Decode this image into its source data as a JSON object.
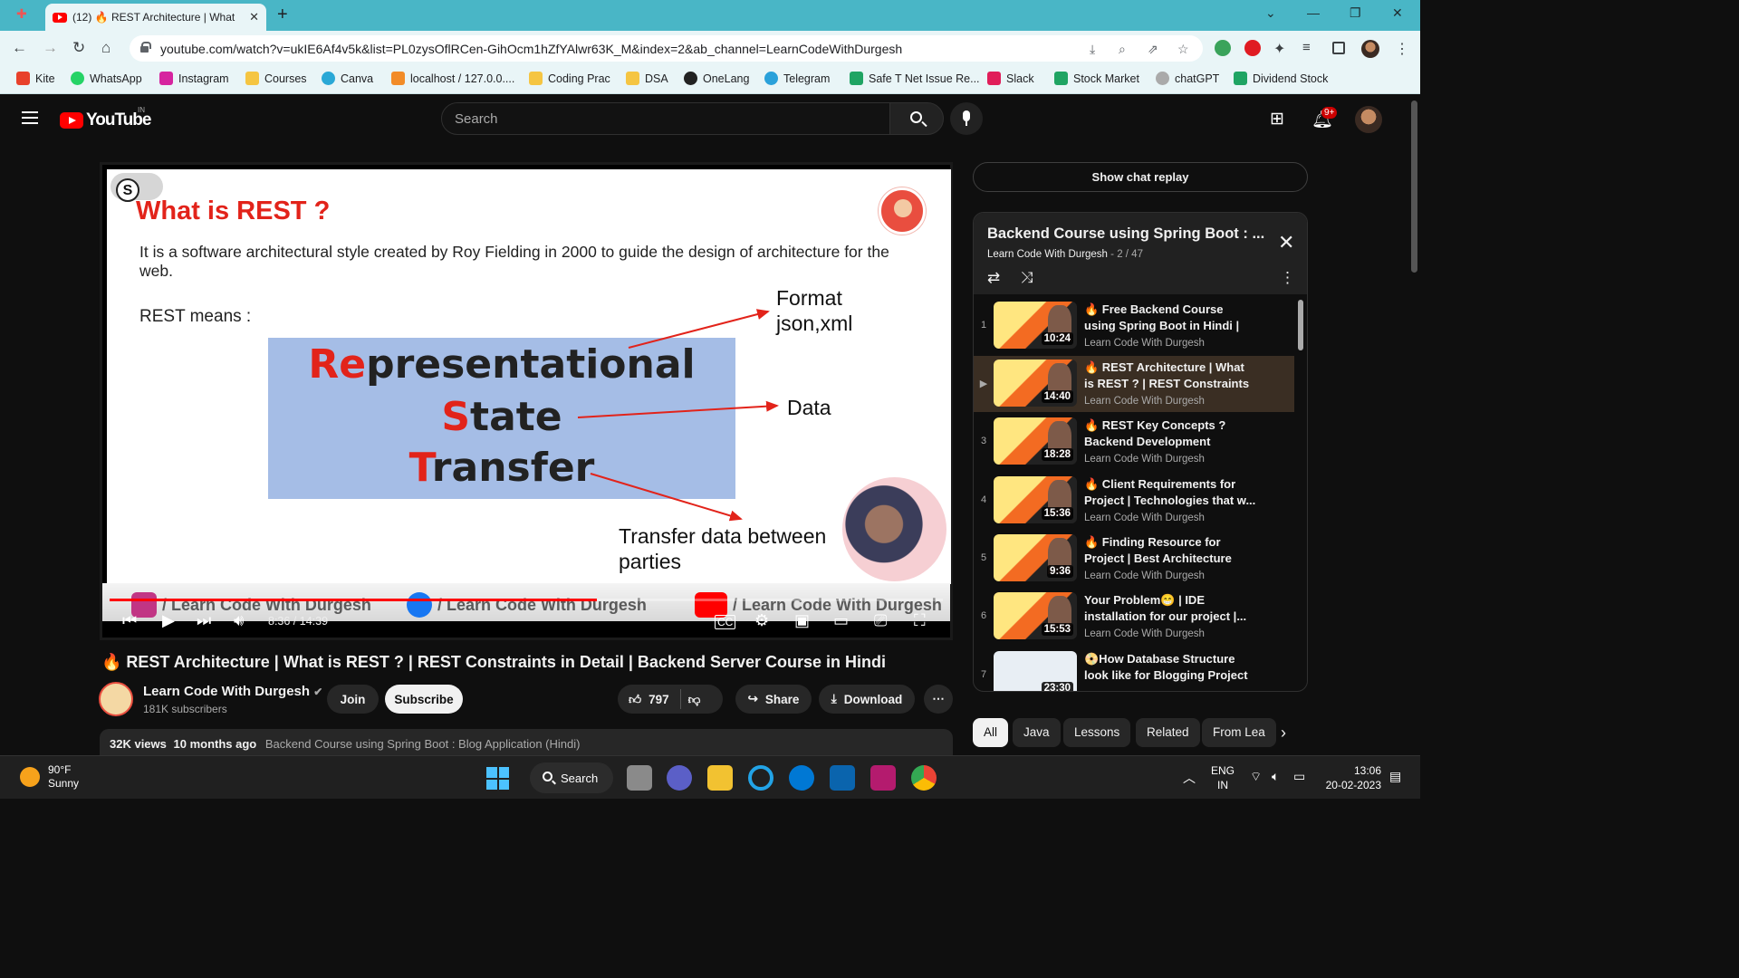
{
  "browser": {
    "tab_title": "(12) 🔥 REST Architecture | What",
    "url": "youtube.com/watch?v=ukIE6Af4v5k&list=PL0zysOflRCen-GihOcm1hZfYAlwr63K_M&index=2&ab_channel=LearnCodeWithDurgesh",
    "bookmarks": [
      "Kite",
      "WhatsApp",
      "Instagram",
      "Courses",
      "Canva",
      "localhost / 127.0.0....",
      "Coding Prac",
      "DSA",
      "OneLang",
      "Telegram",
      "Safe T Net Issue Re...",
      "Slack",
      "Stock Market",
      "chatGPT",
      "Dividend Stock"
    ]
  },
  "youtube": {
    "logo_text": "YouTube",
    "region": "IN",
    "search_placeholder": "Search",
    "notification_count": "9+"
  },
  "slide": {
    "toggle_letter": "S",
    "title": "What is REST  ?",
    "description": "It is a software architectural style created by Roy Fielding in 2000 to guide the design of architecture for the web.",
    "means_label": "REST means :",
    "word1_head": "Re",
    "word1_tail": "presentational",
    "word2_head": "S",
    "word2_tail": "tate",
    "word3_head": "T",
    "word3_tail": "ransfer",
    "note_format_1": "Format",
    "note_format_2": "json,xml",
    "note_data": "Data",
    "note_transfer_1": "Transfer data between",
    "note_transfer_2": "parties",
    "watermark_1": "/ Learn Code With Durgesh",
    "watermark_2": "/ Learn Code With Durgesh",
    "watermark_3": "/ Learn Code With Durgesh"
  },
  "player": {
    "time": "8:36 / 14:39",
    "progress_fraction": 0.585
  },
  "video": {
    "title": "🔥 REST Architecture | What is REST ? | REST Constraints in Detail | Backend Server Course in Hindi",
    "channel": "Learn Code With Durgesh",
    "subscribers": "181K subscribers",
    "join": "Join",
    "subscribe": "Subscribe",
    "likes": "797",
    "share": "Share",
    "download": "Download",
    "views": "32K views",
    "age": "10 months ago",
    "playlist_link": "Backend Course using Spring Boot : Blog Application (Hindi)"
  },
  "sidebar": {
    "chat_replay": "Show chat replay",
    "playlist_title": "Backend Course using Spring Boot : ...",
    "playlist_channel": "Learn Code With Durgesh",
    "playlist_position": " - 2 / 47",
    "items": [
      {
        "index": "1",
        "title": "🔥 Free Backend Course using Spring Boot in Hindi | Blog...",
        "channel": "Learn Code With Durgesh",
        "duration": "10:24"
      },
      {
        "index": "▶",
        "title": "🔥 REST Architecture | What is REST ? | REST Constraints in...",
        "channel": "Learn Code With Durgesh",
        "duration": "14:40"
      },
      {
        "index": "3",
        "title": "🔥 REST Key Concepts ? Backend Development Cours...",
        "channel": "Learn Code With Durgesh",
        "duration": "18:28"
      },
      {
        "index": "4",
        "title": "🔥 Client Requirements for Project | Technologies that w...",
        "channel": "Learn Code With Durgesh",
        "duration": "15:36"
      },
      {
        "index": "5",
        "title": "🔥 Finding Resource for Project | Best Architecture for...",
        "channel": "Learn Code With Durgesh",
        "duration": "9:36"
      },
      {
        "index": "6",
        "title": "Your Problem😁 | IDE installation for our project |...",
        "channel": "Learn Code With Durgesh",
        "duration": "15:53"
      },
      {
        "index": "7",
        "title": "📀How Database Structure look like for Blogging Project ...",
        "channel": "",
        "duration": "23:30"
      }
    ],
    "chips": [
      "All",
      "Java",
      "Lessons",
      "Related",
      "From Lea"
    ]
  },
  "taskbar": {
    "temperature": "90°F",
    "condition": "Sunny",
    "search": "Search",
    "lang_1": "ENG",
    "lang_2": "IN",
    "time": "13:06",
    "date": "20-02-2023"
  },
  "colors": {
    "accent_red": "#ff0000",
    "slide_red": "#e2231a",
    "slide_box": "#a5bde6",
    "chrome_teal": "#49b6c6"
  }
}
